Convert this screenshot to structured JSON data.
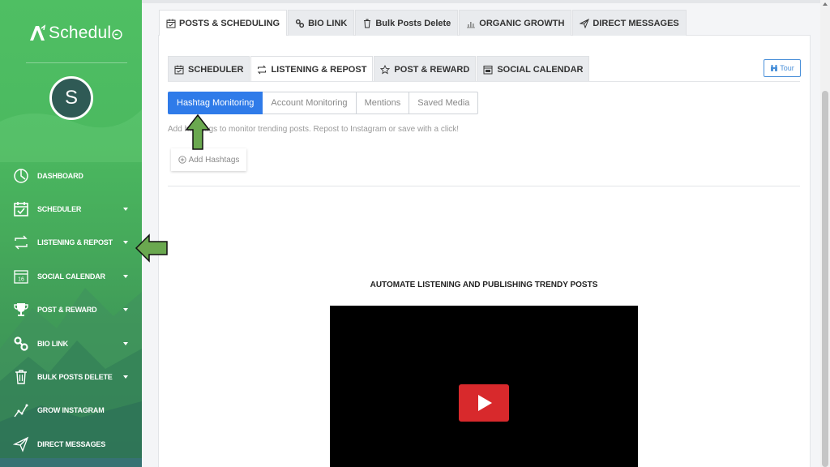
{
  "brand": {
    "name": "Schedul",
    "accent_color": "#2f7be9",
    "sidebar_color": "#46ab5b"
  },
  "user": {
    "avatar_initial": "S"
  },
  "sidebar": {
    "items": [
      {
        "label": "DASHBOARD",
        "icon": "dashboard-gauge-icon",
        "has_caret": false
      },
      {
        "label": "SCHEDULER",
        "icon": "calendar-check-icon",
        "has_caret": true
      },
      {
        "label": "LISTENING & REPOST",
        "icon": "repost-icon",
        "has_caret": true
      },
      {
        "label": "SOCIAL CALENDAR",
        "icon": "calendar-16-icon",
        "has_caret": true
      },
      {
        "label": "POST & REWARD",
        "icon": "trophy-icon",
        "has_caret": true
      },
      {
        "label": "BIO LINK",
        "icon": "link-icon",
        "has_caret": true
      },
      {
        "label": "BULK POSTS DELETE",
        "icon": "trash-icon",
        "has_caret": true
      },
      {
        "label": "GROW INSTAGRAM",
        "icon": "growth-chart-icon",
        "has_caret": false
      },
      {
        "label": "DIRECT MESSAGES",
        "icon": "paper-plane-icon",
        "has_caret": false
      }
    ]
  },
  "top_tabs": [
    {
      "label": "POSTS & SCHEDULING",
      "icon": "calendar-check-icon",
      "active": true
    },
    {
      "label": "BIO LINK",
      "icon": "link-icon",
      "active": false
    },
    {
      "label": "Bulk Posts Delete",
      "icon": "trash-icon",
      "active": false
    },
    {
      "label": "ORGANIC GROWTH",
      "icon": "bar-chart-icon",
      "active": false
    },
    {
      "label": "DIRECT MESSAGES",
      "icon": "paper-plane-icon",
      "active": false
    }
  ],
  "sub_tabs": [
    {
      "label": "SCHEDULER",
      "icon": "calendar-check-icon",
      "active": false
    },
    {
      "label": "LISTENING & REPOST",
      "icon": "repost-icon",
      "active": true
    },
    {
      "label": "POST & REWARD",
      "icon": "star-icon",
      "active": false
    },
    {
      "label": "SOCIAL CALENDAR",
      "icon": "calendar-icon",
      "active": false
    }
  ],
  "tour_button": {
    "label": "Tour",
    "icon": "binoculars-icon"
  },
  "monitoring_tabs": [
    {
      "label": "Hashtag Monitoring",
      "active": true
    },
    {
      "label": "Account Monitoring",
      "active": false
    },
    {
      "label": "Mentions",
      "active": false
    },
    {
      "label": "Saved Media",
      "active": false
    }
  ],
  "help_text": "Add hashtags to monitor trending posts. Repost to Instagram or save with a click!",
  "add_hashtags_label": "Add Hashtags",
  "video": {
    "title": "AUTOMATE LISTENING AND PUBLISHING TRENDY POSTS",
    "play_color": "#d8292c"
  },
  "annotation_color": "#6aa84f"
}
